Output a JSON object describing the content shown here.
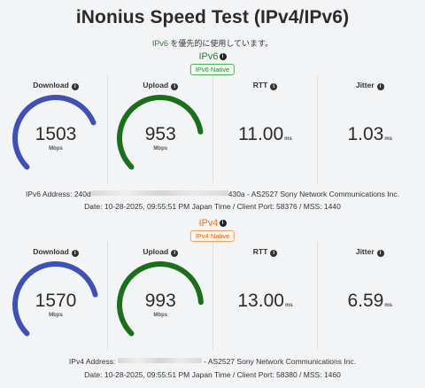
{
  "title": "iNonius Speed Test (IPv4/IPv6)",
  "preference": {
    "proto": "IPv6",
    "text": " を優先的に使用しています。"
  },
  "ipv6": {
    "label": "IPv6",
    "badge": "IPv6 Native",
    "download": {
      "label": "Download",
      "value": "1503",
      "unit": "Mbps",
      "fraction": 0.75
    },
    "upload": {
      "label": "Upload",
      "value": "953",
      "unit": "Mbps",
      "fraction": 0.8
    },
    "rtt": {
      "label": "RTT",
      "value": "11.00",
      "unit": "ms"
    },
    "jitter": {
      "label": "Jitter",
      "value": "1.03",
      "unit": "ms"
    },
    "address_prefix": "IPv6 Address: 240d",
    "address_suffix": "430a - AS2527 Sony Network Communications Inc.",
    "date_line": "Date: 10-28-2025, 09:55:51 PM Japan Time / Client Port: 58376 / MSS: 1440"
  },
  "ipv4": {
    "label": "IPv4",
    "badge": "IPv4 Native",
    "download": {
      "label": "Download",
      "value": "1570",
      "unit": "Mbps",
      "fraction": 0.78
    },
    "upload": {
      "label": "Upload",
      "value": "993",
      "unit": "Mbps",
      "fraction": 0.82
    },
    "rtt": {
      "label": "RTT",
      "value": "13.00",
      "unit": "ms"
    },
    "jitter": {
      "label": "Jitter",
      "value": "6.59",
      "unit": "ms"
    },
    "address_prefix": "IPv4 Address: ",
    "address_suffix": " - AS2527 Sony Network Communications Inc.",
    "date_line": "Date: 10-28-2025, 09:55:51 PM Japan Time / Client Port: 58380 / MSS: 1460"
  },
  "colors": {
    "download": "#3f51b5",
    "upload": "#1b6e1b",
    "ipv6_label": "#2e7d32",
    "ipv4_label": "#e8751a"
  },
  "info_glyph": "i"
}
